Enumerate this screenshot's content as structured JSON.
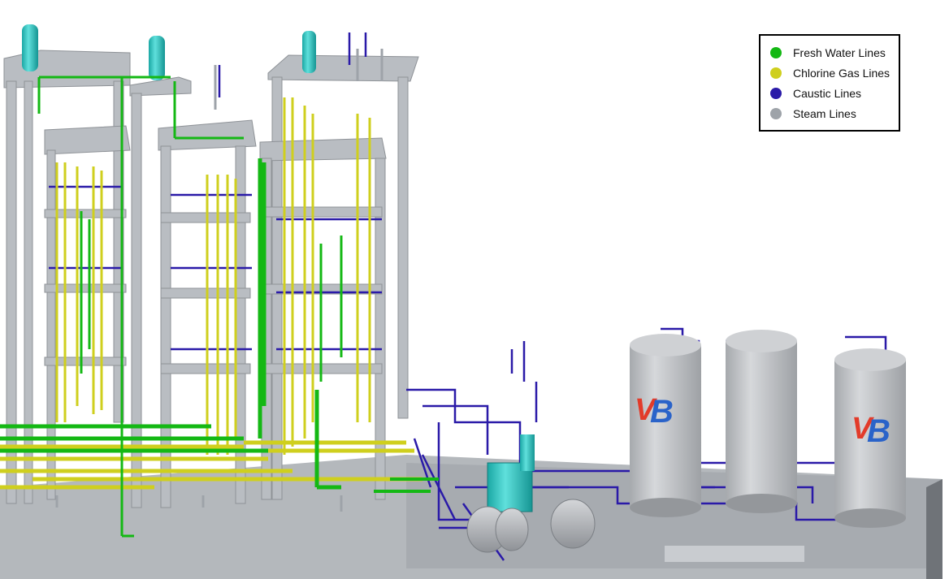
{
  "legend": {
    "items": [
      {
        "label": "Fresh Water Lines",
        "color": "#14b814"
      },
      {
        "label": "Chlorine Gas Lines",
        "color": "#cfcf1e"
      },
      {
        "label": "Caustic Lines",
        "color": "#2a1aa8"
      },
      {
        "label": "Steam Lines",
        "color": "#9ea3a9"
      }
    ]
  },
  "logo": {
    "text": "VB"
  },
  "colors": {
    "structure": "#b9bdc2",
    "structure_dark": "#8e9297",
    "floor": "#a9adb2",
    "tank": "#c3c6ca",
    "vessel_cyan": "#27c7c4",
    "logo_red": "#e23b2a",
    "logo_blue": "#2a63c9"
  }
}
